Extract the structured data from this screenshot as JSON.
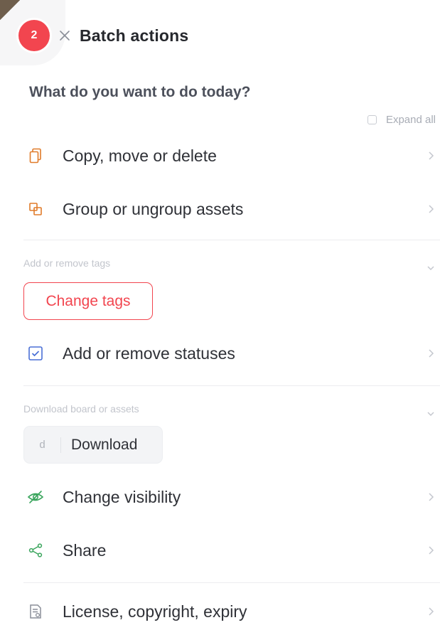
{
  "header": {
    "count": "2",
    "title": "Batch actions"
  },
  "question": "What do you want to do today?",
  "expand_all": "Expand all",
  "actions": {
    "copy": "Copy, move or delete",
    "group": "Group or ungroup assets",
    "statuses": "Add or remove statuses",
    "visibility": "Change visibility",
    "share": "Share",
    "license": "License, copyright, expiry"
  },
  "sections": {
    "tags_label": "Add or remove tags",
    "tags_button": "Change tags",
    "download_label": "Download board or assets",
    "download_shortcut": "d",
    "download_button": "Download"
  },
  "colors": {
    "accent": "#f2454f",
    "copy_icon": "#e07b2a",
    "status_icon": "#4a6fd6",
    "green_icon": "#3aa55d"
  },
  "icons": {
    "close": "close-icon",
    "copy": "copy-icon",
    "group": "group-icon",
    "status": "checkbox-icon",
    "visibility": "eye-slash-icon",
    "share": "share-icon",
    "license": "document-icon",
    "chevron_right": "chevron-right-icon",
    "chevron_down": "chevron-down-icon"
  }
}
